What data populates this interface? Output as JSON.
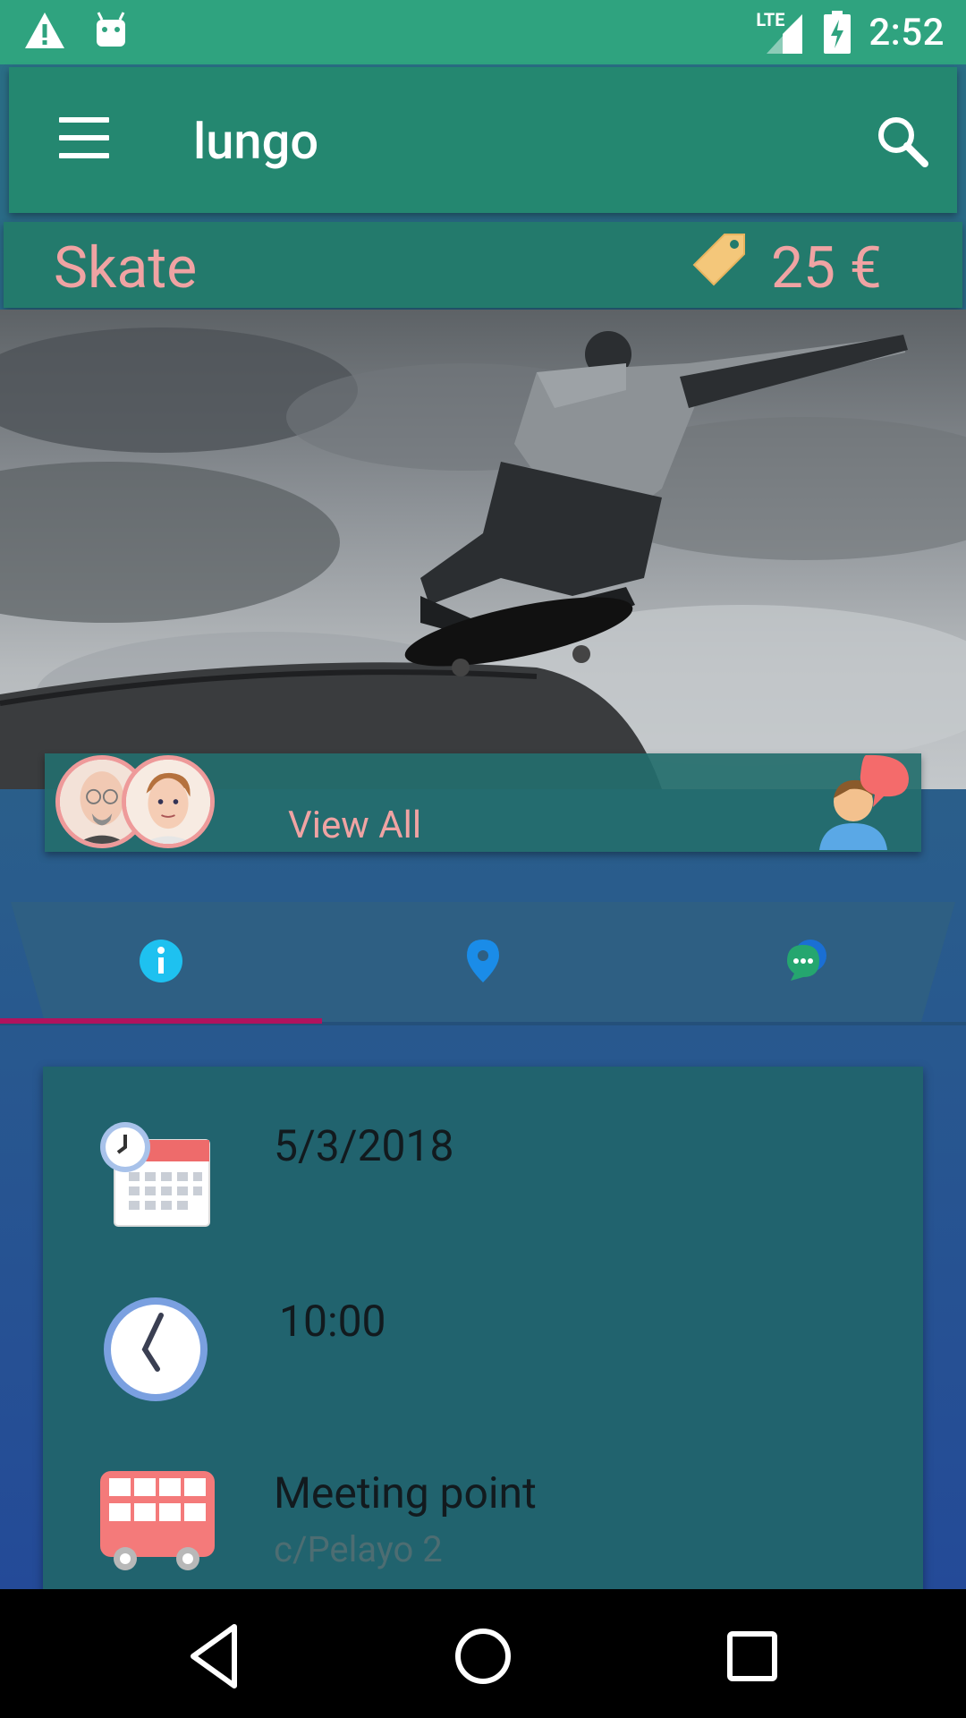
{
  "status_bar": {
    "time": "2:52",
    "network": "LTE",
    "icons": [
      "warning-icon",
      "android-debug-icon",
      "signal-icon",
      "battery-charging-icon"
    ]
  },
  "app_bar": {
    "title": "lungo",
    "menu_icon": "hamburger-menu-icon",
    "search_icon": "search-icon"
  },
  "activity": {
    "name": "Skate",
    "price": "25 €",
    "price_icon": "price-tag-icon"
  },
  "hero": {
    "image": "skateboarder-jump-photo"
  },
  "participants": {
    "view_all_label": "View All",
    "avatars": [
      "avatar-bald-glasses-man",
      "avatar-young-man"
    ],
    "chat_icon": "person-chat-icon"
  },
  "tabs": [
    {
      "name": "info",
      "icon": "info-icon",
      "selected": true
    },
    {
      "name": "location",
      "icon": "map-pin-icon",
      "selected": false
    },
    {
      "name": "chat",
      "icon": "chat-bubbles-icon",
      "selected": false
    }
  ],
  "details": {
    "date": "5/3/2018",
    "time": "10:00",
    "meeting_label": "Meeting point",
    "meeting_address": "c/Pelayo 2"
  },
  "colors": {
    "status_bar": "#2fa37f",
    "app_bar": "#248770",
    "accent_text": "#f0a3a3",
    "tab_indicator": "#b0135e"
  }
}
